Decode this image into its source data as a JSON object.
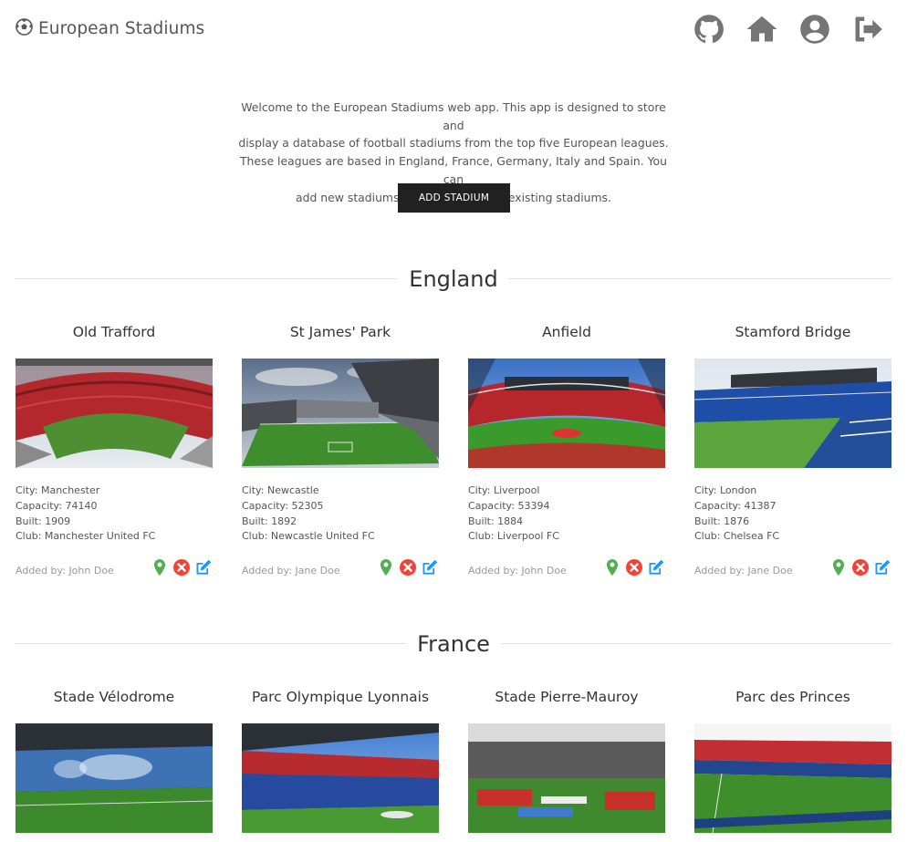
{
  "app": {
    "title": "European Stadiums",
    "logo_icon": "soccer-ball-icon"
  },
  "nav": [
    {
      "name": "github",
      "icon": "github-icon"
    },
    {
      "name": "home",
      "icon": "home-icon"
    },
    {
      "name": "profile",
      "icon": "user-circle-icon"
    },
    {
      "name": "logout",
      "icon": "logout-icon"
    }
  ],
  "intro": {
    "lines": [
      "Welcome to the European Stadiums web app. This app is designed to store and",
      "display a database of football stadiums from the top five European leagues.",
      "These leagues are based in England, France, Germany, Italy and Spain. You can",
      "add new stadiums or update/remove existing stadiums."
    ]
  },
  "add_button": "ADD STADIUM",
  "colors": {
    "accent_dark": "#212121",
    "map_pin": "#4caf50",
    "delete": "#f44336",
    "edit": "#2196f3"
  },
  "sections": [
    {
      "country": "England",
      "stadiums": [
        {
          "name": "Old Trafford",
          "city": "City: Manchester",
          "capacity": "Capacity: 74140",
          "built": "Built: 1909",
          "club": "Club: Manchester United FC",
          "added_by": "Added by: John Doe",
          "theme": "red"
        },
        {
          "name": "St James' Park",
          "city": "City: Newcastle",
          "capacity": "Capacity: 52305",
          "built": "Built: 1892",
          "club": "Club: Newcastle United FC",
          "added_by": "Added by: Jane Doe",
          "theme": "grey"
        },
        {
          "name": "Anfield",
          "city": "City: Liverpool",
          "capacity": "Capacity: 53394",
          "built": "Built: 1884",
          "club": "Club: Liverpool FC",
          "added_by": "Added by: John Doe",
          "theme": "red2"
        },
        {
          "name": "Stamford Bridge",
          "city": "City: London",
          "capacity": "Capacity: 41387",
          "built": "Built: 1876",
          "club": "Club: Chelsea FC",
          "added_by": "Added by: Jane Doe",
          "theme": "blue"
        }
      ]
    },
    {
      "country": "France",
      "stadiums": [
        {
          "name": "Stade Vélodrome",
          "theme": "marseille"
        },
        {
          "name": "Parc Olympique Lyonnais",
          "theme": "lyon"
        },
        {
          "name": "Stade Pierre-Mauroy",
          "theme": "lille"
        },
        {
          "name": "Parc des Princes",
          "theme": "psg"
        }
      ]
    }
  ]
}
